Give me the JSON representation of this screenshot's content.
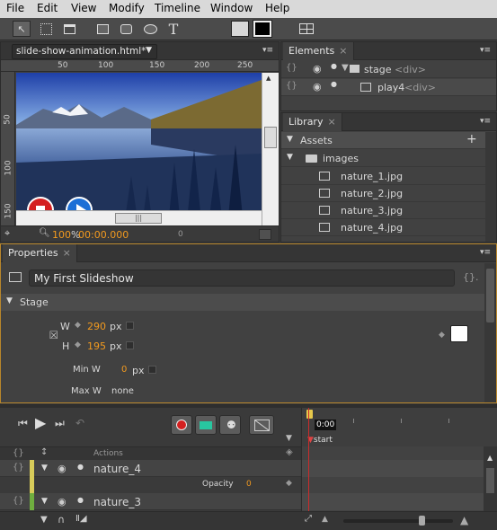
{
  "menu": [
    "File",
    "Edit",
    "View",
    "Modify",
    "Timeline",
    "Window",
    "Help"
  ],
  "doc": {
    "tab": "slide-show-animation.html*",
    "ruler_top": [
      "50",
      "100",
      "150",
      "200",
      "250"
    ],
    "ruler_left": [
      "50",
      "100",
      "150"
    ],
    "zoom": "100",
    "zoom_unit": "%",
    "timecode": "00:00.000",
    "zero": "0"
  },
  "elements": {
    "tab": "Elements",
    "rows": [
      {
        "name": "stage",
        "tag": "<div>"
      },
      {
        "name": "play4",
        "tag": "<div>"
      }
    ]
  },
  "library": {
    "tab": "Library",
    "assets": "Assets",
    "folder": "images",
    "files": [
      "nature_1.jpg",
      "nature_2.jpg",
      "nature_3.jpg",
      "nature_4.jpg"
    ]
  },
  "properties": {
    "tab": "Properties",
    "title": "My First Slideshow",
    "section": "Stage",
    "w_label": "W",
    "w": "290",
    "h_label": "H",
    "h": "195",
    "unit": "px",
    "minw_label": "Min W",
    "minw": "0",
    "maxw_label": "Max W",
    "maxw": "none",
    "stage_color": "#ffffff"
  },
  "timeline": {
    "actions": "Actions",
    "time": "0:00",
    "start": "start",
    "tracks": [
      {
        "name": "nature_4",
        "color": "#d8cc5a"
      },
      {
        "name": "nature_3",
        "color": "#6fae3f"
      }
    ],
    "prop_label": "Opacity",
    "prop_value": "0"
  }
}
